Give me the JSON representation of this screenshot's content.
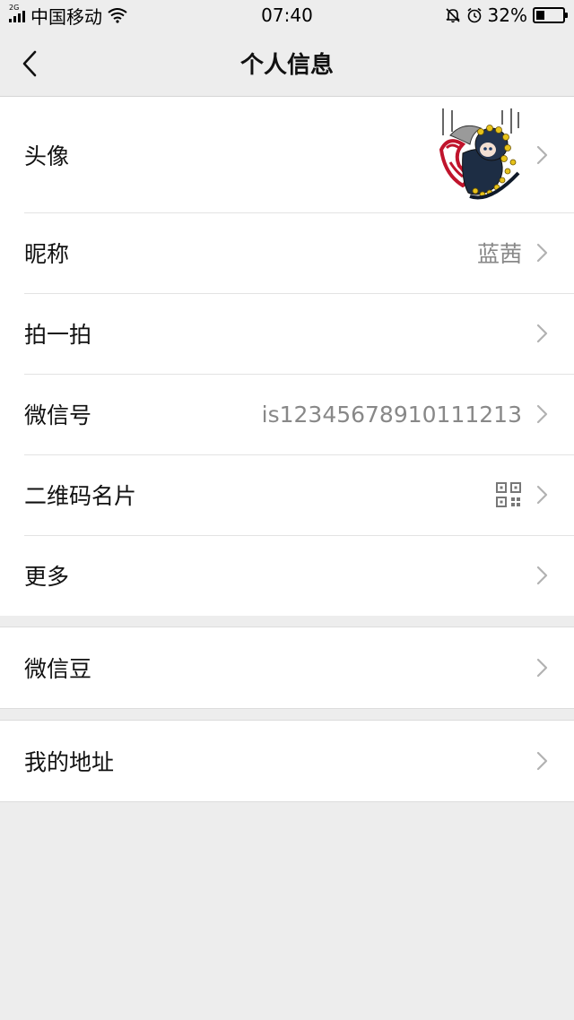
{
  "status_bar": {
    "network_type": "2G",
    "carrier": "中国移动",
    "time": "07:40",
    "battery_percent": "32%",
    "battery_level": 0.32,
    "icons": [
      "signal-icon",
      "wifi-icon",
      "mute-bell-icon",
      "alarm-icon",
      "battery-icon"
    ]
  },
  "nav": {
    "back_icon": "chevron-left-icon",
    "title": "个人信息"
  },
  "groups": [
    {
      "items": [
        {
          "label": "头像",
          "value": "",
          "accessory": "avatar-image"
        },
        {
          "label": "昵称",
          "value": "蓝茜"
        },
        {
          "label": "拍一拍",
          "value": ""
        },
        {
          "label": "微信号",
          "value": "is12345678910111213"
        },
        {
          "label": "二维码名片",
          "value": "",
          "accessory": "qr-code-icon"
        },
        {
          "label": "更多",
          "value": ""
        }
      ]
    },
    {
      "items": [
        {
          "label": "微信豆",
          "value": ""
        }
      ]
    },
    {
      "items": [
        {
          "label": "我的地址",
          "value": ""
        }
      ]
    }
  ],
  "colors": {
    "background": "#ededed",
    "card": "#ffffff",
    "secondary_text": "#888888",
    "chevron": "#b2b2b2"
  }
}
